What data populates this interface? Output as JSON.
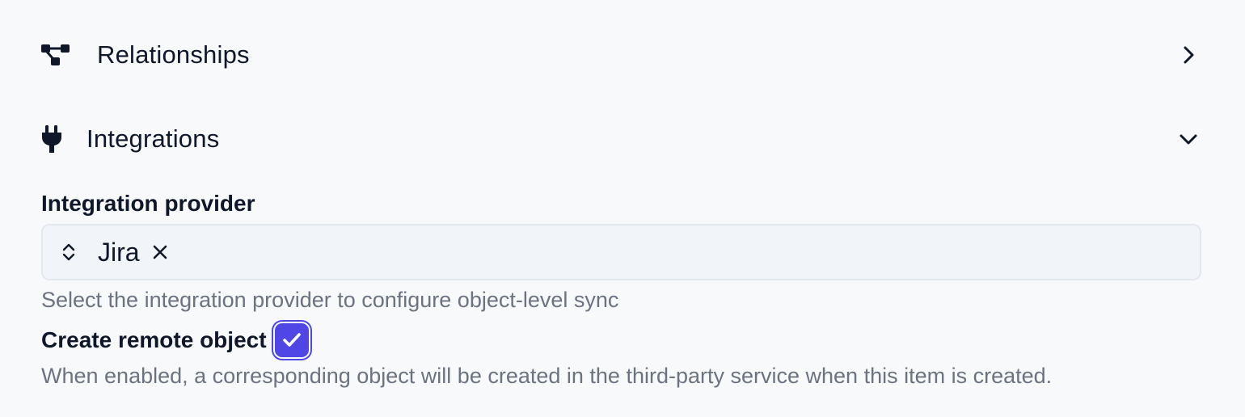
{
  "sections": {
    "relationships": {
      "label": "Relationships",
      "icon": "relationships-icon",
      "state": "collapsed"
    },
    "integrations": {
      "label": "Integrations",
      "icon": "plug-icon",
      "state": "expanded"
    }
  },
  "integration_provider": {
    "label": "Integration provider",
    "selected_value": "Jira",
    "help": "Select the integration provider to configure object-level sync"
  },
  "create_remote_object": {
    "label": "Create remote object",
    "checked": true,
    "help": "When enabled, a corresponding object will be created in the third-party service when this item is created."
  },
  "colors": {
    "accent": "#4f46e5",
    "muted_text": "#6b7280",
    "background": "#f8f9fb",
    "input_background": "#f1f4f8"
  }
}
